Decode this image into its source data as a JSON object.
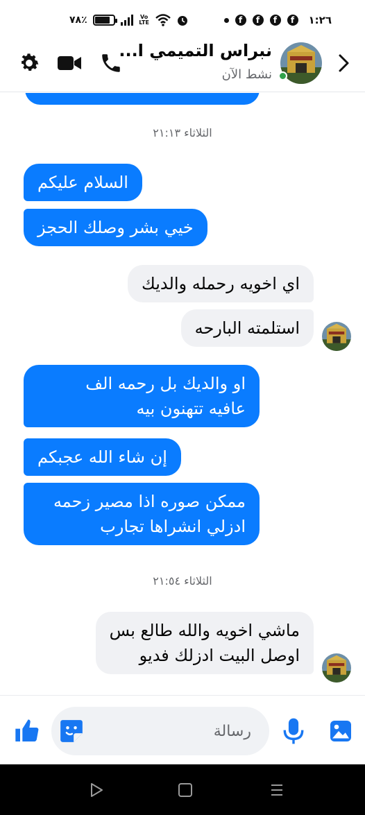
{
  "status_bar": {
    "battery_text": "٧٨٪",
    "battery_level": 0.78,
    "network_label": "Vo LTE",
    "time": "١:٢٦",
    "notification_icons": [
      "facebook-icon",
      "facebook-icon",
      "facebook-icon",
      "facebook-icon"
    ]
  },
  "header": {
    "contact_name": "نبراس التميمي ا...",
    "status": "نشط الآن",
    "online_color": "#31a24c"
  },
  "messages": [
    {
      "type": "timestamp",
      "text": "الثلاثاء ٢١:١٣"
    },
    {
      "type": "outgoing",
      "lines": [
        "السلام عليكم"
      ]
    },
    {
      "type": "outgoing",
      "lines": [
        "خيي بشر وصلك الحجز"
      ]
    },
    {
      "type": "incoming",
      "lines": [
        "اي اخويه رحمله والديك"
      ]
    },
    {
      "type": "incoming",
      "lines": [
        "استلمته البارحه"
      ]
    },
    {
      "type": "outgoing",
      "lines": [
        "او والديك بل رحمه الف",
        "عافيه تتهنون بيه"
      ]
    },
    {
      "type": "outgoing",
      "lines": [
        "إن شاء الله عجبكم"
      ]
    },
    {
      "type": "outgoing",
      "lines": [
        "ممكن صوره اذا مصير زحمه",
        "ادزلي انشراها تجارب"
      ]
    },
    {
      "type": "timestamp",
      "text": "الثلاثاء ٢١:٥٤"
    },
    {
      "type": "incoming",
      "lines": [
        "ماشي اخويه والله طالع بس",
        "اوصل البيت ادزلك فديو"
      ]
    }
  ],
  "composer": {
    "placeholder": "رسالة",
    "value": ""
  },
  "colors": {
    "accent": "#0a7cff",
    "incoming_bubble": "#f0f1f4",
    "icon_blue": "#1877f2"
  }
}
